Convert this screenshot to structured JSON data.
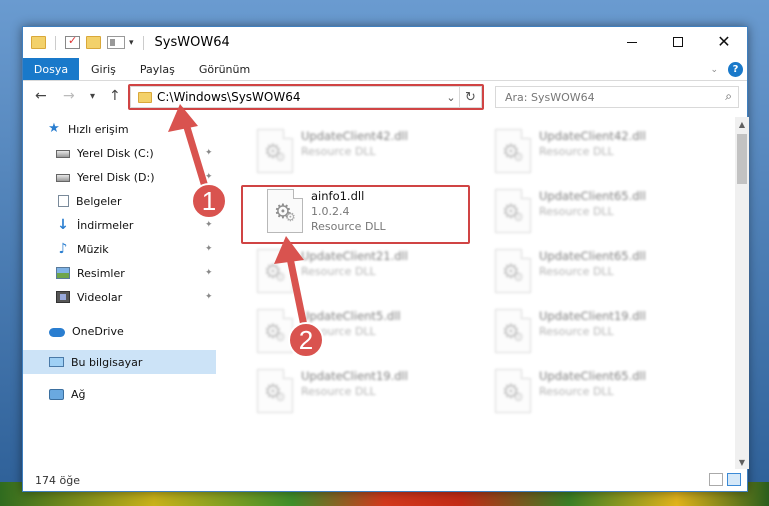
{
  "window": {
    "title": "SysWOW64",
    "close_glyph": "✕",
    "max_label": "",
    "min_label": ""
  },
  "ribbon": {
    "tabs": [
      "Dosya",
      "Giriş",
      "Paylaş",
      "Görünüm"
    ],
    "help_glyph": "?"
  },
  "nav": {
    "back": "←",
    "forward": "→",
    "recent": "▾",
    "up": "↑",
    "address": "C:\\Windows\\SysWOW64",
    "refresh": "↻",
    "search_placeholder": "Ara: SysWOW64",
    "search_glyph": "⌕"
  },
  "sidebar": {
    "items": [
      {
        "label": "Hızlı erişim",
        "icon": "star-icon"
      },
      {
        "label": "Yerel Disk (C:)",
        "icon": "drive-icon",
        "pinned": true
      },
      {
        "label": "Yerel Disk (D:)",
        "icon": "drive-icon",
        "pinned": true
      },
      {
        "label": "Belgeler",
        "icon": "document-icon",
        "pinned": true
      },
      {
        "label": "İndirmeler",
        "icon": "download-icon",
        "pinned": true
      },
      {
        "label": "Müzik",
        "icon": "music-icon",
        "pinned": true
      },
      {
        "label": "Resimler",
        "icon": "picture-icon",
        "pinned": true
      },
      {
        "label": "Videolar",
        "icon": "video-icon",
        "pinned": true
      },
      {
        "label": "OneDrive",
        "icon": "cloud-icon"
      },
      {
        "label": "Bu bilgisayar",
        "icon": "computer-icon",
        "selected": true
      },
      {
        "label": "Ağ",
        "icon": "network-icon"
      }
    ],
    "pin_glyph": "📌"
  },
  "files": [
    {
      "name": "UpdateClient42.dll",
      "sub1": "Resource DLL",
      "sub2": ""
    },
    {
      "name": "UpdateClient42.dll",
      "sub1": "Resource DLL",
      "sub2": ""
    },
    {
      "name": "ainfo1.dll",
      "sub1": "1.0.2.4",
      "sub2": "Resource DLL"
    },
    {
      "name": "UpdateClient65.dll",
      "sub1": "Resource DLL",
      "sub2": ""
    },
    {
      "name": "UpdateClient21.dll",
      "sub1": "Resource DLL",
      "sub2": ""
    },
    {
      "name": "UpdateClient65.dll",
      "sub1": "Resource DLL",
      "sub2": ""
    },
    {
      "name": "UpdateClient5.dll",
      "sub1": "Resource DLL",
      "sub2": ""
    },
    {
      "name": "UpdateClient19.dll",
      "sub1": "Resource DLL",
      "sub2": ""
    },
    {
      "name": "UpdateClient19.dll",
      "sub1": "Resource DLL",
      "sub2": ""
    },
    {
      "name": "UpdateClient65.dll",
      "sub1": "Resource DLL",
      "sub2": ""
    }
  ],
  "status": {
    "count": "174 öğe"
  },
  "annotations": {
    "badge1": "1",
    "badge2": "2",
    "highlight_color": "#d04444",
    "badge_color": "#d9534f"
  },
  "colors": {
    "accent": "#1979ca",
    "selection": "#cce3f7"
  }
}
